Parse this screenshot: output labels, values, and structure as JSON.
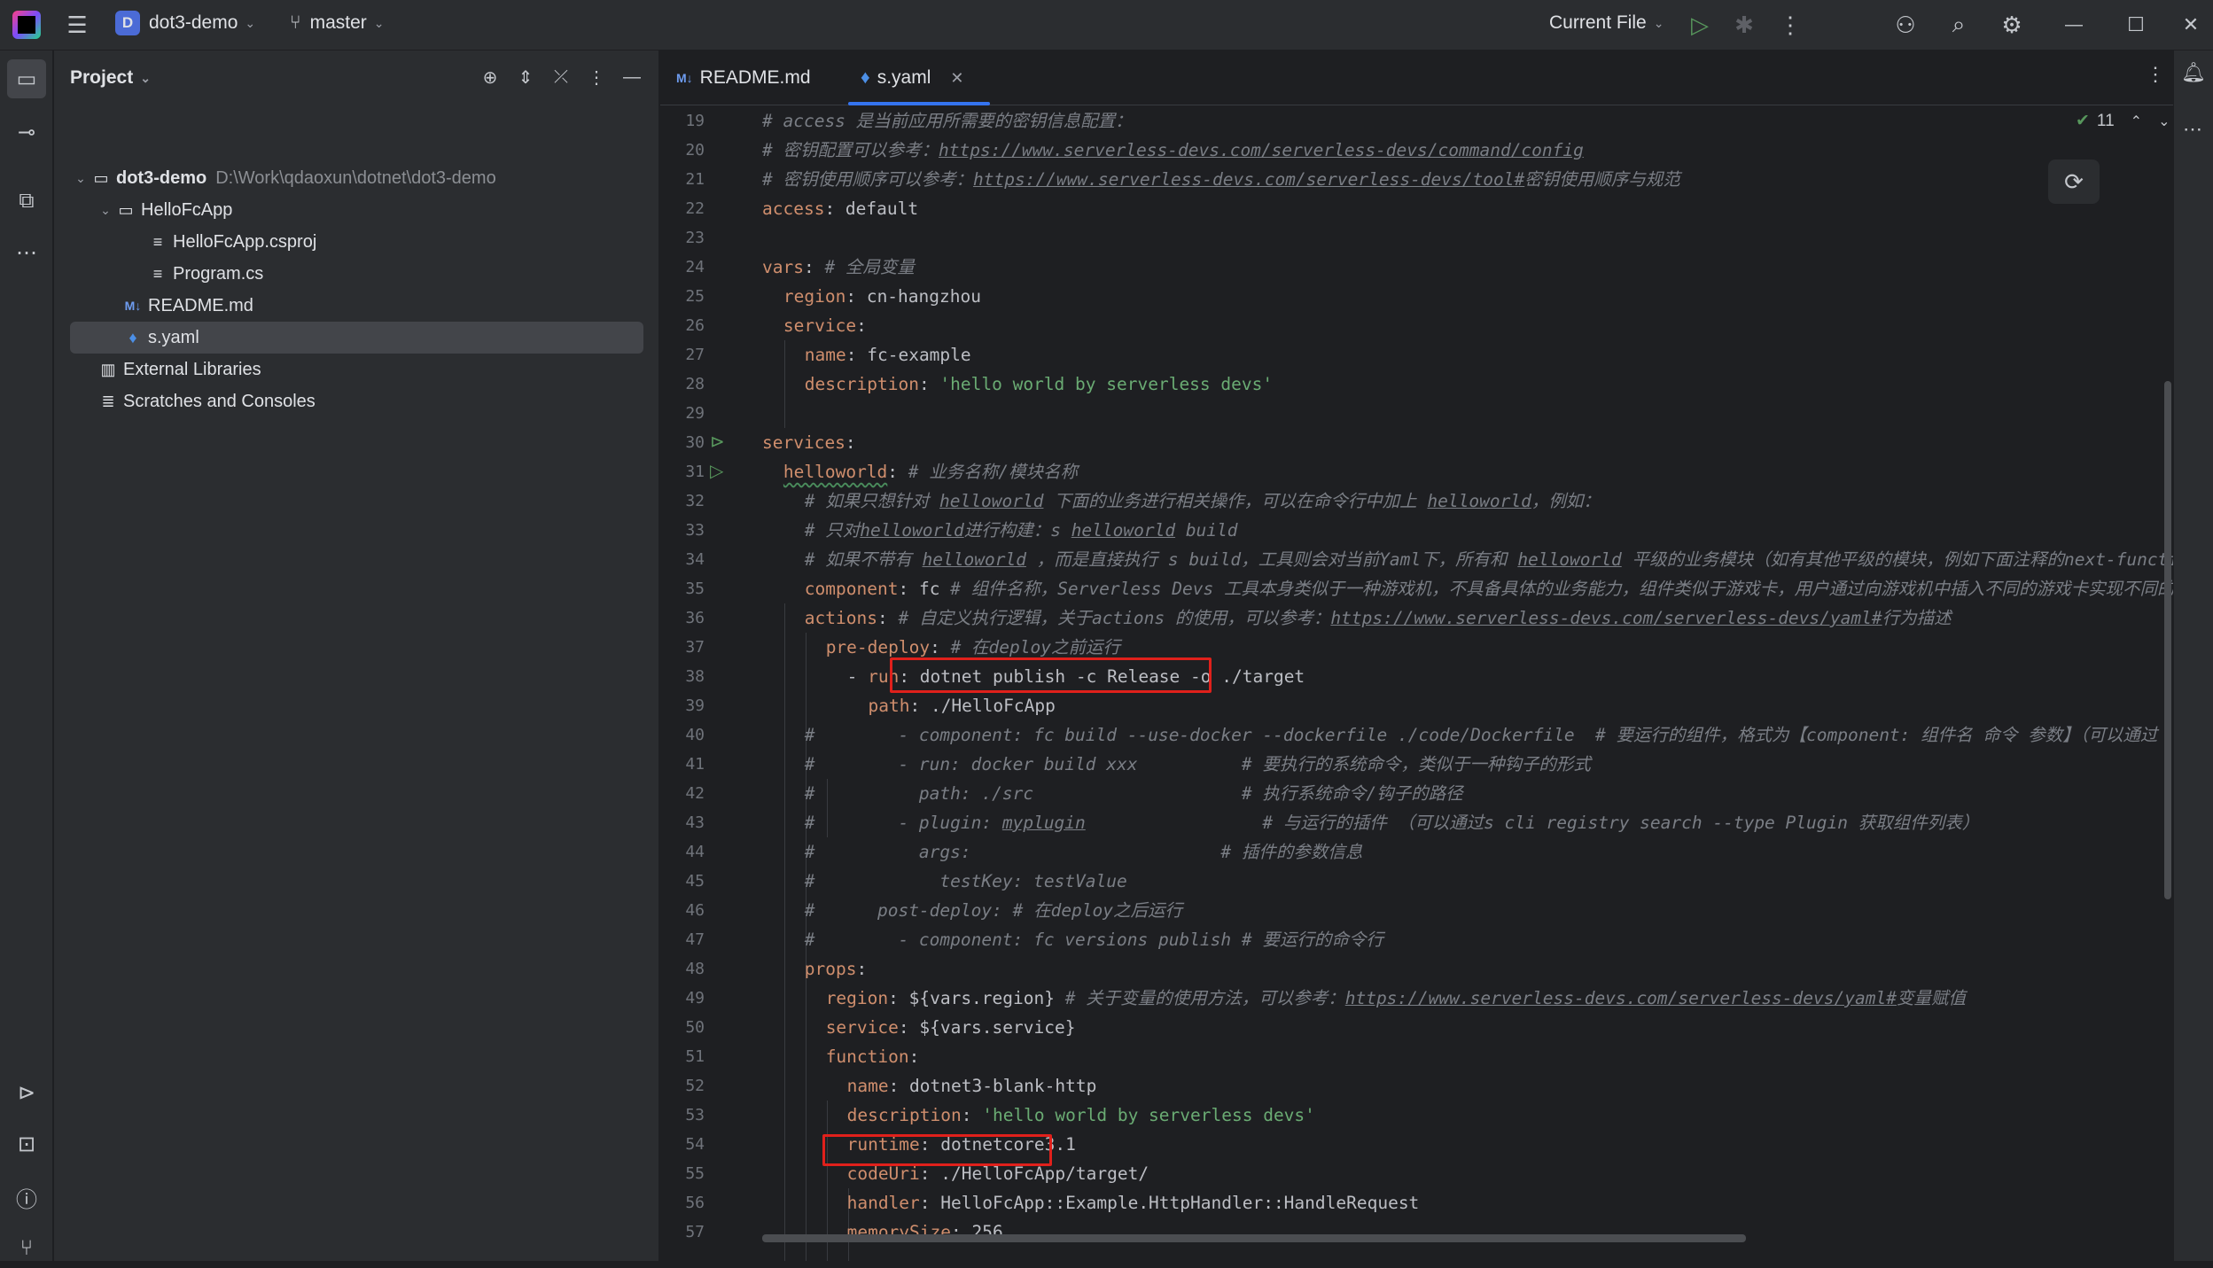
{
  "titlebar": {
    "project_badge": "D",
    "project_name": "dot3-demo",
    "branch": "master",
    "run_config": "Current File"
  },
  "project_panel": {
    "title": "Project",
    "tree": [
      {
        "label": "dot3-demo",
        "path": "D:\\Work\\qdaoxun\\dotnet\\dot3-demo"
      },
      {
        "label": "HelloFcApp"
      },
      {
        "label": "HelloFcApp.csproj"
      },
      {
        "label": "Program.cs"
      },
      {
        "label": "README.md"
      },
      {
        "label": "s.yaml"
      },
      {
        "label": "External Libraries"
      },
      {
        "label": "Scratches and Consoles"
      }
    ]
  },
  "tabs": [
    {
      "label": "README.md",
      "icon": "M↓"
    },
    {
      "label": "s.yaml",
      "icon": "yaml-icon"
    }
  ],
  "inspection": {
    "count": "11"
  },
  "lines": [
    "19",
    "20",
    "21",
    "22",
    "23",
    "24",
    "25",
    "26",
    "27",
    "28",
    "29",
    "30",
    "31",
    "32",
    "33",
    "34",
    "35",
    "36",
    "37",
    "38",
    "39",
    "40",
    "41",
    "42",
    "43",
    "44",
    "45",
    "46",
    "47",
    "48",
    "49",
    "50",
    "51",
    "52",
    "53",
    "54",
    "55",
    "56",
    "57"
  ],
  "code": {
    "l19": {
      "t1": "# access ",
      "t2": "是当前应用所需要的密钥信息配置："
    },
    "l20": {
      "t1": "# 密钥配置可以参考：",
      "u": "https://www.serverless-devs.com/serverless-devs/command/config"
    },
    "l21": {
      "t1": "# 密钥使用顺序可以参考：",
      "u": "https://www.serverless-devs.com/serverless-devs/tool#",
      "t2": "密钥使用顺序与规范"
    },
    "l22": {
      "k": "access",
      "v": ": default"
    },
    "l24": {
      "k": "vars",
      "v": ": ",
      "c": "# 全局变量"
    },
    "l25": {
      "k": "region",
      "v": ": cn-hangzhou"
    },
    "l26": {
      "k": "service",
      "v": ":"
    },
    "l27": {
      "k": "name",
      "v": ": fc-example"
    },
    "l28": {
      "k": "description",
      "v": ": ",
      "s": "'hello world by serverless devs'"
    },
    "l30": {
      "k": "services",
      "v": ":"
    },
    "l31": {
      "k": "helloworld",
      "v": ": ",
      "c": "# 业务名称/模块名称"
    },
    "l32": {
      "c1": "# 如果只想针对 ",
      "u1": "helloworld",
      "c2": " 下面的业务进行相关操作，可以在命令行中加上 ",
      "u2": "helloworld",
      "c3": "，例如："
    },
    "l33": {
      "c1": "# 只对",
      "u1": "helloworld",
      "c2": "进行构建：s ",
      "u2": "helloworld",
      "c3": " build"
    },
    "l34": {
      "c1": "# 如果不带有 ",
      "u1": "helloworld",
      "c2": " ，而是直接执行 s build，工具则会对当前Yaml下，所有和 ",
      "u2": "helloworld",
      "c3": " 平级的业务模块（如有其他平级的模块，例如下面注释的next-function"
    },
    "l35": {
      "k": "component",
      "v": ": fc ",
      "c": "# 组件名称，Serverless Devs 工具本身类似于一种游戏机，不具备具体的业务能力，组件类似于游戏卡，用户通过向游戏机中插入不同的游戏卡实现不同的功能"
    },
    "l36": {
      "k": "actions",
      "v": ": ",
      "c": "# 自定义执行逻辑，关于actions 的使用，可以参考：",
      "u": "https://www.serverless-devs.com/serverless-devs/yaml#",
      "c2": "行为描述"
    },
    "l37": {
      "k": "pre-deploy",
      "v": ": ",
      "c": "# 在deploy之前运行"
    },
    "l38": {
      "d": "- ",
      "k": "run",
      "v": ": dotnet publish -c Release -o ./target"
    },
    "l39": {
      "k": "path",
      "v": ": ./HelloFcApp"
    },
    "l40": {
      "c": "#        - component: fc build --use-docker --dockerfile ./code/Dockerfile  # 要运行的组件，格式为【component: 组件名 命令 参数】（可以通过"
    },
    "l41": {
      "c": "#        - run: docker build xxx          # 要执行的系统命令，类似于一种钩子的形式"
    },
    "l42": {
      "c": "#          path: ./src                    # 执行系统命令/钩子的路径"
    },
    "l43": {
      "c1": "#        - plugin: ",
      "u": "myplugin",
      "c2": "                 # 与运行的插件 （可以通过s cli registry search --type Plugin 获取组件列表）"
    },
    "l44": {
      "c": "#          args:                        # 插件的参数信息"
    },
    "l45": {
      "c": "#            testKey: testValue"
    },
    "l46": {
      "c": "#      post-deploy: # 在deploy之后运行"
    },
    "l47": {
      "c": "#        - component: fc versions publish # 要运行的命令行"
    },
    "l48": {
      "k": "props",
      "v": ":"
    },
    "l49": {
      "k": "region",
      "v": ": ${vars.region} ",
      "c": "# 关于变量的使用方法，可以参考：",
      "u": "https://www.serverless-devs.com/serverless-devs/yaml#",
      "c2": "变量赋值"
    },
    "l50": {
      "k": "service",
      "v": ": ${vars.service}"
    },
    "l51": {
      "k": "function",
      "v": ":"
    },
    "l52": {
      "k": "name",
      "v": ": dotnet3-blank-http"
    },
    "l53": {
      "k": "description",
      "v": ": ",
      "s": "'hello world by serverless devs'"
    },
    "l54": {
      "k": "runtime",
      "v": ": dotnetcore3.1"
    },
    "l55": {
      "k": "codeUri",
      "v": ": ./HelloFcApp/target/"
    },
    "l56": {
      "k": "handler",
      "v": ": HelloFcApp::Example.HttpHandler::HandleRequest"
    },
    "l57": {
      "k": "memorySize",
      "v": ": 256"
    }
  },
  "colors": {
    "accent": "#3574f0",
    "highlight_box": "#e0201b",
    "keyword": "#cf8e6d",
    "string": "#6aab73",
    "comment": "#7a7e85"
  }
}
